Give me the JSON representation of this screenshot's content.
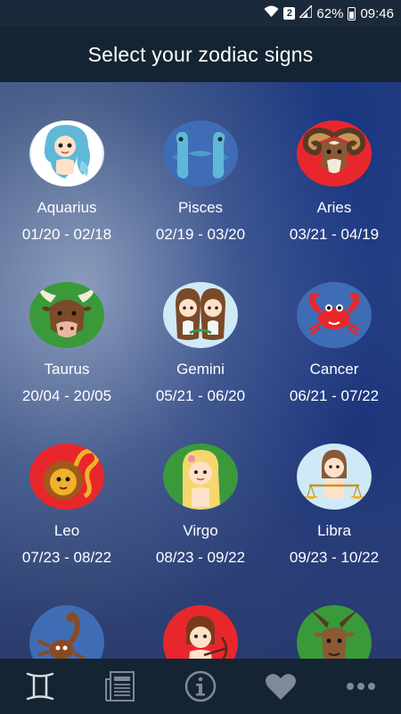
{
  "status_bar": {
    "sim_number": "2",
    "battery": "62%",
    "time": "09:46",
    "icons": [
      "wifi-icon",
      "sim-icon",
      "signal-icon",
      "battery-icon"
    ]
  },
  "header": {
    "title": "Select your zodiac signs"
  },
  "signs": [
    {
      "name": "Aquarius",
      "dates": "01/20 - 02/18",
      "icon": "aquarius-icon",
      "color": "#ffffff"
    },
    {
      "name": "Pisces",
      "dates": "02/19 - 03/20",
      "icon": "pisces-icon",
      "color": "#3f6db5"
    },
    {
      "name": "Aries",
      "dates": "03/21 - 04/19",
      "icon": "aries-icon",
      "color": "#e8272d"
    },
    {
      "name": "Taurus",
      "dates": "20/04 - 20/05",
      "icon": "taurus-icon",
      "color": "#3a9a3a"
    },
    {
      "name": "Gemini",
      "dates": "05/21 - 06/20",
      "icon": "gemini-icon",
      "color": "#ffffff"
    },
    {
      "name": "Cancer",
      "dates": "06/21 - 07/22",
      "icon": "cancer-icon",
      "color": "#3f6db5"
    },
    {
      "name": "Leo",
      "dates": "07/23 - 08/22",
      "icon": "leo-icon",
      "color": "#e8272d"
    },
    {
      "name": "Virgo",
      "dates": "08/23 - 09/22",
      "icon": "virgo-icon",
      "color": "#3a9a3a"
    },
    {
      "name": "Libra",
      "dates": "09/23 - 10/22",
      "icon": "libra-icon",
      "color": "#ffffff"
    },
    {
      "name": "",
      "dates": "",
      "icon": "scorpio-icon",
      "color": "#3f6db5"
    },
    {
      "name": "",
      "dates": "",
      "icon": "sagittarius-icon",
      "color": "#e8272d"
    },
    {
      "name": "",
      "dates": "",
      "icon": "capricorn-icon",
      "color": "#3a9a3a"
    }
  ],
  "bottom_nav": {
    "items": [
      "gemini-symbol-icon",
      "newspaper-icon",
      "info-icon",
      "heart-icon",
      "more-icon"
    ]
  }
}
